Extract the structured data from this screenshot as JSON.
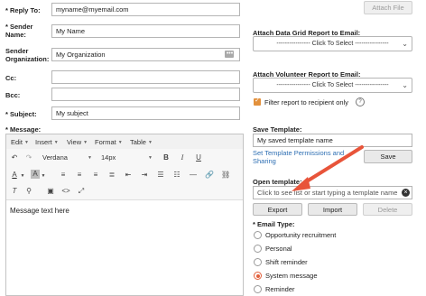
{
  "left_form": {
    "reply_to": {
      "label": "* Reply To:",
      "value": "myname@myemail.com"
    },
    "sender_name": {
      "label_line1": "* Sender",
      "label_line2": "Name:",
      "value": "My Name"
    },
    "sender_org": {
      "label_line1": "Sender",
      "label_line2": "Organization:",
      "value": "My Organization"
    },
    "cc": {
      "label": "Cc:",
      "value": ""
    },
    "bcc": {
      "label": "Bcc:",
      "value": ""
    },
    "subject": {
      "label": "* Subject:",
      "value": "My subject"
    },
    "message": {
      "label": "* Message:"
    }
  },
  "editor": {
    "menus": [
      "Edit",
      "Insert",
      "View",
      "Format",
      "Table"
    ],
    "font_family": "Verdana",
    "font_size": "14px",
    "content": "Message text here"
  },
  "right_panel": {
    "attach_file_label": "Attach File",
    "data_grid": {
      "label": "Attach Data Grid Report to Email:",
      "placeholder": "---------------- Click To Select ----------------"
    },
    "volunteer": {
      "label": "Attach Volunteer Report to Email:",
      "placeholder": "---------------- Click To Select ----------------"
    },
    "filter_checkbox": {
      "label": "Filter report to recipient only",
      "checked": true,
      "help_icon": "?"
    },
    "save_template": {
      "label": "Save Template:",
      "value": "My saved template name",
      "permissions_link_line1": "Set Template Permissions and",
      "permissions_link_line2": "Sharing",
      "save_button": "Save"
    },
    "open_template": {
      "label": "Open template:",
      "placeholder": "Click to see list or start typing a template name",
      "export_button": "Export",
      "import_button": "Import",
      "delete_button": "Delete"
    },
    "email_type": {
      "label": "* Email Type:",
      "options": [
        {
          "label": "Opportunity recruitment",
          "selected": false
        },
        {
          "label": "Personal",
          "selected": false
        },
        {
          "label": "Shift reminder",
          "selected": false
        },
        {
          "label": "System message",
          "selected": true
        },
        {
          "label": "Reminder",
          "selected": false
        }
      ]
    }
  },
  "colors": {
    "accent": "#e2603c",
    "link": "#2e6fb3",
    "arrow": "#e8543a"
  }
}
